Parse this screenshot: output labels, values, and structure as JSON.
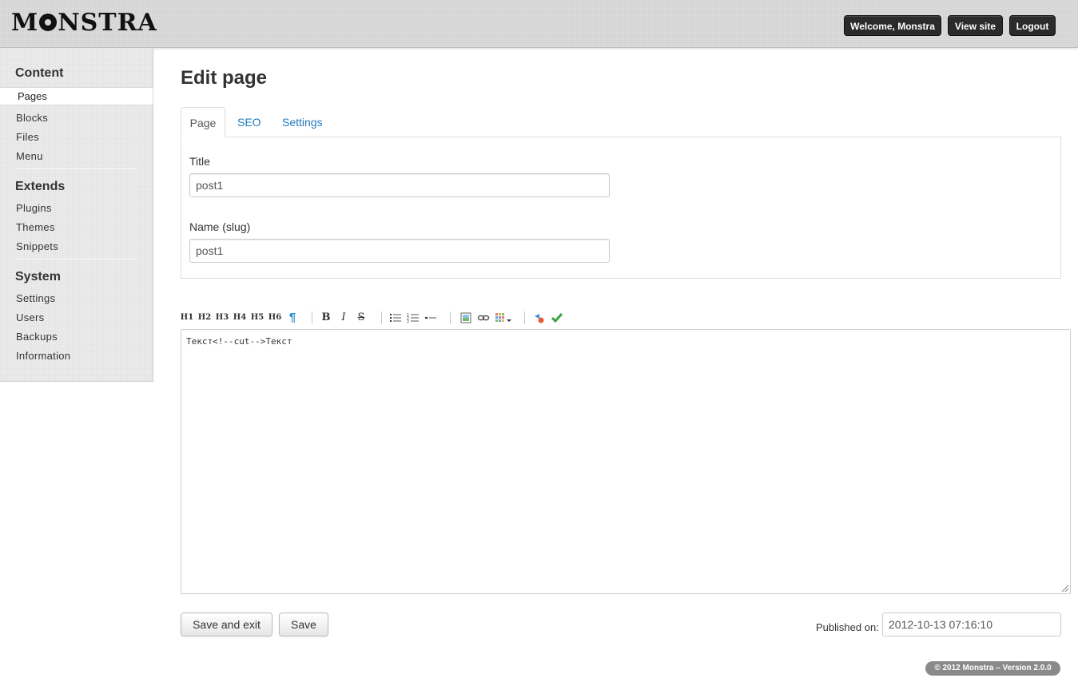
{
  "header": {
    "logo_text": "MONSTRA",
    "welcome_label": "Welcome, Monstra",
    "view_site_label": "View site",
    "logout_label": "Logout"
  },
  "sidebar": {
    "sections": [
      {
        "heading": "Content",
        "items": [
          "Pages",
          "Blocks",
          "Files",
          "Menu"
        ]
      },
      {
        "heading": "Extends",
        "items": [
          "Plugins",
          "Themes",
          "Snippets"
        ]
      },
      {
        "heading": "System",
        "items": [
          "Settings",
          "Users",
          "Backups",
          "Information"
        ]
      }
    ],
    "active_item": "Pages"
  },
  "main": {
    "title": "Edit page",
    "tabs": [
      {
        "label": "Page",
        "active": true
      },
      {
        "label": "SEO",
        "active": false
      },
      {
        "label": "Settings",
        "active": false
      }
    ],
    "form": {
      "title_label": "Title",
      "title_value": "post1",
      "slug_label": "Name (slug)",
      "slug_value": "post1"
    },
    "toolbar": {
      "h1": "H1",
      "h2": "H2",
      "h3": "H3",
      "h4": "H4",
      "h5": "H5",
      "h6": "H6",
      "paragraph": "¶",
      "bold": "B",
      "italic": "I",
      "strike": "S",
      "icons": [
        "unordered-list-icon",
        "ordered-list-icon",
        "horizontal-rule-icon",
        "image-icon",
        "link-icon",
        "table-icon",
        "cut-icon",
        "check-icon"
      ]
    },
    "editor_content": "Текст<!--cut-->Текст",
    "save_exit_label": "Save and exit",
    "save_label": "Save",
    "published_label": "Published on:",
    "published_value": "2012-10-13 07:16:10"
  },
  "footer": {
    "text": "© 2012 Monstra – Version 2.0.0"
  },
  "colors": {
    "link": "#1e7bbf",
    "header_button": "#2b2b2b"
  }
}
